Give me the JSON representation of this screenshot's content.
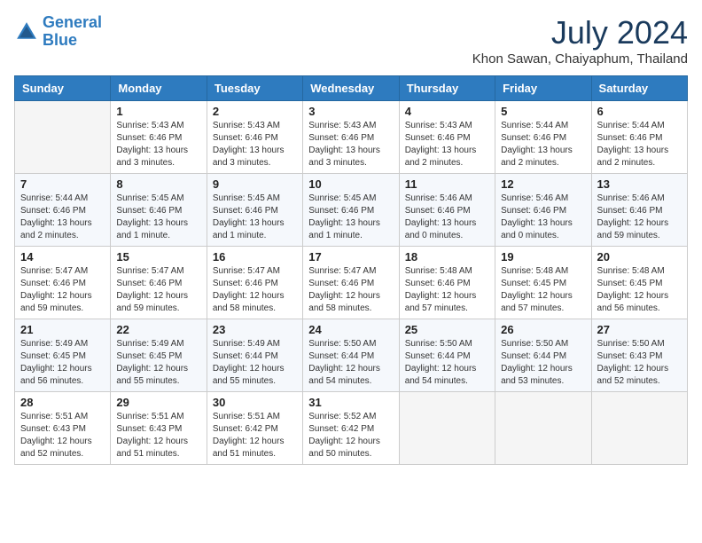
{
  "header": {
    "logo_line1": "General",
    "logo_line2": "Blue",
    "month": "July 2024",
    "location": "Khon Sawan, Chaiyaphum, Thailand"
  },
  "weekdays": [
    "Sunday",
    "Monday",
    "Tuesday",
    "Wednesday",
    "Thursday",
    "Friday",
    "Saturday"
  ],
  "weeks": [
    [
      {
        "day": "",
        "empty": true
      },
      {
        "day": "1",
        "sunrise": "Sunrise: 5:43 AM",
        "sunset": "Sunset: 6:46 PM",
        "daylight": "Daylight: 13 hours and 3 minutes."
      },
      {
        "day": "2",
        "sunrise": "Sunrise: 5:43 AM",
        "sunset": "Sunset: 6:46 PM",
        "daylight": "Daylight: 13 hours and 3 minutes."
      },
      {
        "day": "3",
        "sunrise": "Sunrise: 5:43 AM",
        "sunset": "Sunset: 6:46 PM",
        "daylight": "Daylight: 13 hours and 3 minutes."
      },
      {
        "day": "4",
        "sunrise": "Sunrise: 5:43 AM",
        "sunset": "Sunset: 6:46 PM",
        "daylight": "Daylight: 13 hours and 2 minutes."
      },
      {
        "day": "5",
        "sunrise": "Sunrise: 5:44 AM",
        "sunset": "Sunset: 6:46 PM",
        "daylight": "Daylight: 13 hours and 2 minutes."
      },
      {
        "day": "6",
        "sunrise": "Sunrise: 5:44 AM",
        "sunset": "Sunset: 6:46 PM",
        "daylight": "Daylight: 13 hours and 2 minutes."
      }
    ],
    [
      {
        "day": "7",
        "sunrise": "Sunrise: 5:44 AM",
        "sunset": "Sunset: 6:46 PM",
        "daylight": "Daylight: 13 hours and 2 minutes."
      },
      {
        "day": "8",
        "sunrise": "Sunrise: 5:45 AM",
        "sunset": "Sunset: 6:46 PM",
        "daylight": "Daylight: 13 hours and 1 minute."
      },
      {
        "day": "9",
        "sunrise": "Sunrise: 5:45 AM",
        "sunset": "Sunset: 6:46 PM",
        "daylight": "Daylight: 13 hours and 1 minute."
      },
      {
        "day": "10",
        "sunrise": "Sunrise: 5:45 AM",
        "sunset": "Sunset: 6:46 PM",
        "daylight": "Daylight: 13 hours and 1 minute."
      },
      {
        "day": "11",
        "sunrise": "Sunrise: 5:46 AM",
        "sunset": "Sunset: 6:46 PM",
        "daylight": "Daylight: 13 hours and 0 minutes."
      },
      {
        "day": "12",
        "sunrise": "Sunrise: 5:46 AM",
        "sunset": "Sunset: 6:46 PM",
        "daylight": "Daylight: 13 hours and 0 minutes."
      },
      {
        "day": "13",
        "sunrise": "Sunrise: 5:46 AM",
        "sunset": "Sunset: 6:46 PM",
        "daylight": "Daylight: 12 hours and 59 minutes."
      }
    ],
    [
      {
        "day": "14",
        "sunrise": "Sunrise: 5:47 AM",
        "sunset": "Sunset: 6:46 PM",
        "daylight": "Daylight: 12 hours and 59 minutes."
      },
      {
        "day": "15",
        "sunrise": "Sunrise: 5:47 AM",
        "sunset": "Sunset: 6:46 PM",
        "daylight": "Daylight: 12 hours and 59 minutes."
      },
      {
        "day": "16",
        "sunrise": "Sunrise: 5:47 AM",
        "sunset": "Sunset: 6:46 PM",
        "daylight": "Daylight: 12 hours and 58 minutes."
      },
      {
        "day": "17",
        "sunrise": "Sunrise: 5:47 AM",
        "sunset": "Sunset: 6:46 PM",
        "daylight": "Daylight: 12 hours and 58 minutes."
      },
      {
        "day": "18",
        "sunrise": "Sunrise: 5:48 AM",
        "sunset": "Sunset: 6:46 PM",
        "daylight": "Daylight: 12 hours and 57 minutes."
      },
      {
        "day": "19",
        "sunrise": "Sunrise: 5:48 AM",
        "sunset": "Sunset: 6:45 PM",
        "daylight": "Daylight: 12 hours and 57 minutes."
      },
      {
        "day": "20",
        "sunrise": "Sunrise: 5:48 AM",
        "sunset": "Sunset: 6:45 PM",
        "daylight": "Daylight: 12 hours and 56 minutes."
      }
    ],
    [
      {
        "day": "21",
        "sunrise": "Sunrise: 5:49 AM",
        "sunset": "Sunset: 6:45 PM",
        "daylight": "Daylight: 12 hours and 56 minutes."
      },
      {
        "day": "22",
        "sunrise": "Sunrise: 5:49 AM",
        "sunset": "Sunset: 6:45 PM",
        "daylight": "Daylight: 12 hours and 55 minutes."
      },
      {
        "day": "23",
        "sunrise": "Sunrise: 5:49 AM",
        "sunset": "Sunset: 6:44 PM",
        "daylight": "Daylight: 12 hours and 55 minutes."
      },
      {
        "day": "24",
        "sunrise": "Sunrise: 5:50 AM",
        "sunset": "Sunset: 6:44 PM",
        "daylight": "Daylight: 12 hours and 54 minutes."
      },
      {
        "day": "25",
        "sunrise": "Sunrise: 5:50 AM",
        "sunset": "Sunset: 6:44 PM",
        "daylight": "Daylight: 12 hours and 54 minutes."
      },
      {
        "day": "26",
        "sunrise": "Sunrise: 5:50 AM",
        "sunset": "Sunset: 6:44 PM",
        "daylight": "Daylight: 12 hours and 53 minutes."
      },
      {
        "day": "27",
        "sunrise": "Sunrise: 5:50 AM",
        "sunset": "Sunset: 6:43 PM",
        "daylight": "Daylight: 12 hours and 52 minutes."
      }
    ],
    [
      {
        "day": "28",
        "sunrise": "Sunrise: 5:51 AM",
        "sunset": "Sunset: 6:43 PM",
        "daylight": "Daylight: 12 hours and 52 minutes."
      },
      {
        "day": "29",
        "sunrise": "Sunrise: 5:51 AM",
        "sunset": "Sunset: 6:43 PM",
        "daylight": "Daylight: 12 hours and 51 minutes."
      },
      {
        "day": "30",
        "sunrise": "Sunrise: 5:51 AM",
        "sunset": "Sunset: 6:42 PM",
        "daylight": "Daylight: 12 hours and 51 minutes."
      },
      {
        "day": "31",
        "sunrise": "Sunrise: 5:52 AM",
        "sunset": "Sunset: 6:42 PM",
        "daylight": "Daylight: 12 hours and 50 minutes."
      },
      {
        "day": "",
        "empty": true
      },
      {
        "day": "",
        "empty": true
      },
      {
        "day": "",
        "empty": true
      }
    ]
  ]
}
